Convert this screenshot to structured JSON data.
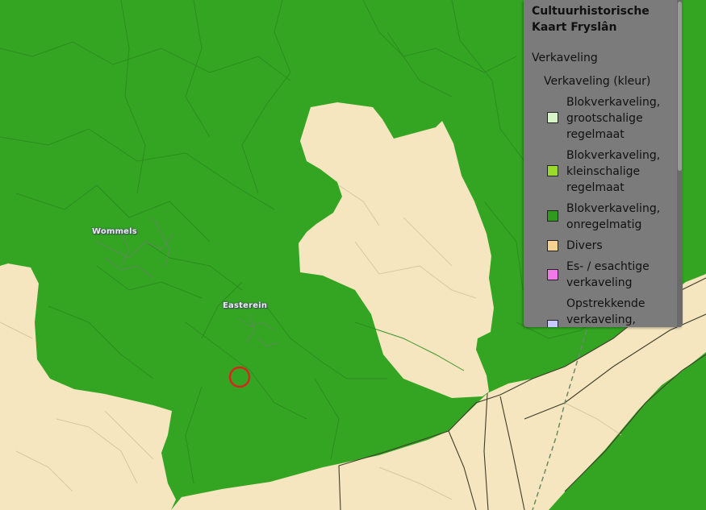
{
  "map": {
    "colors": {
      "green": "#33a523",
      "sand": "#f5e6bf",
      "road": "#5a5a3a",
      "marker": "#d9261c"
    },
    "places": [
      {
        "name": "Wommels"
      },
      {
        "name": "Easterein"
      }
    ],
    "marker_icon": "circle-marker-icon"
  },
  "legend": {
    "title": "Cultuurhistorische Kaart Fryslân",
    "layer_name": "Verkaveling",
    "sublayer_name": "Verkaveling (kleur)",
    "items": [
      {
        "label": "Blokverkaveling, grootschalige regelmaat",
        "color": "#d8f5c9"
      },
      {
        "label": "Blokverkaveling, kleinschalige regelmaat",
        "color": "#9ada2b"
      },
      {
        "label": "Blokverkaveling, onregelmatig",
        "color": "#2f9a1e"
      },
      {
        "label": "Divers",
        "color": "#f5d291"
      },
      {
        "label": "Es- / esachtige verkaveling",
        "color": "#f37ae6"
      },
      {
        "label": "Opstrekkende verkaveling,",
        "color": "#c8c8ff"
      }
    ]
  }
}
